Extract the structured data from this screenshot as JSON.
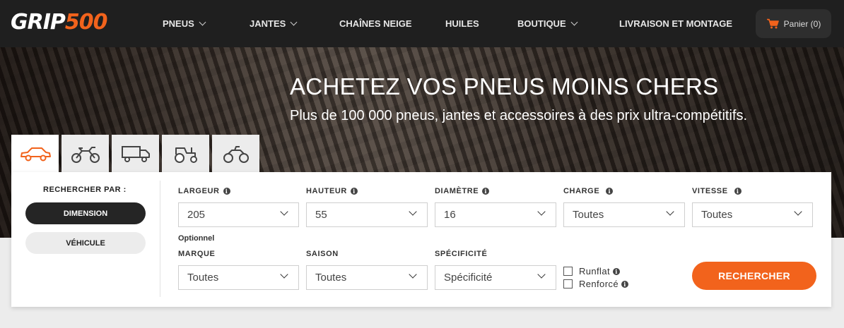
{
  "logo": {
    "part1": "GRIP",
    "part2": "500"
  },
  "nav": {
    "items": [
      {
        "label": "PNEUS",
        "dropdown": true
      },
      {
        "label": "JANTES",
        "dropdown": true
      },
      {
        "label": "CHAÎNES NEIGE",
        "dropdown": false
      },
      {
        "label": "HUILES",
        "dropdown": false
      },
      {
        "label": "BOUTIQUE",
        "dropdown": true
      },
      {
        "label": "LIVRAISON ET MONTAGE",
        "dropdown": false
      }
    ],
    "cart_label": "Panier (0)"
  },
  "hero": {
    "title": "ACHETEZ VOS PNEUS MOINS CHERS",
    "subtitle": "Plus de 100 000 pneus, jantes et accessoires à des prix ultra-compétitifs."
  },
  "vehicle_tabs": [
    {
      "icon": "car-icon",
      "active": true
    },
    {
      "icon": "motorcycle-icon",
      "active": false
    },
    {
      "icon": "truck-icon",
      "active": false
    },
    {
      "icon": "tractor-icon",
      "active": false
    },
    {
      "icon": "quad-icon",
      "active": false
    }
  ],
  "search": {
    "search_by_label": "RECHERCHER PAR :",
    "mode_dimension": "DIMENSION",
    "mode_vehicle": "VÉHICULE",
    "optional_label": "Optionnel",
    "fields": {
      "largeur": {
        "label": "LARGEUR",
        "value": "205"
      },
      "hauteur": {
        "label": "HAUTEUR",
        "value": "55"
      },
      "diametre": {
        "label": "DIAMÈTRE",
        "value": "16"
      },
      "charge": {
        "label": "CHARGE",
        "value": "Toutes"
      },
      "vitesse": {
        "label": "VITESSE",
        "value": "Toutes"
      },
      "marque": {
        "label": "MARQUE",
        "value": "Toutes"
      },
      "saison": {
        "label": "SAISON",
        "value": "Toutes"
      },
      "specificite": {
        "label": "SPÉCIFICITÉ",
        "value": "Spécificité"
      }
    },
    "checkboxes": {
      "runflat": "Runflat",
      "renforce": "Renforcé"
    },
    "submit_label": "RECHERCHER"
  },
  "colors": {
    "accent": "#f2631c",
    "nav_bg": "#1f1f1f",
    "panel_bg": "#ffffff"
  }
}
